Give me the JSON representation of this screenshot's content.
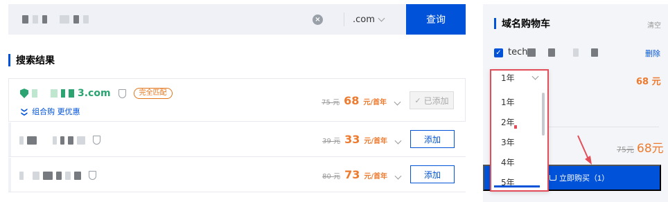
{
  "search": {
    "suffix": ".com",
    "button_label": "查询",
    "clear_symbol": "×"
  },
  "results": {
    "section_title": "搜索结果",
    "rows": [
      {
        "domain_tail": "3.com",
        "match_badge": "完全匹配",
        "combo_link": "组合购 更优惠",
        "old_price": "75 元",
        "price": "68",
        "unit": "元/首年",
        "button_label": "已添加",
        "added": true
      },
      {
        "old_price": "39 元",
        "price": "33",
        "unit": "元/首年",
        "button_label": "添加",
        "added": false
      },
      {
        "old_price": "80 元",
        "price": "73",
        "unit": "元/首年",
        "button_label": "添加",
        "added": false
      }
    ]
  },
  "cart": {
    "title": "域名购物车",
    "clear_label": "清空",
    "item_name": "tech",
    "delete_label": "删除",
    "price": "68 元",
    "selected_term": "1年",
    "total_old": "75元",
    "total_new": "68元",
    "buy_label": "立即购买（1）"
  },
  "term_options": [
    "1年",
    "2年",
    "3年",
    "4年",
    "5年"
  ],
  "colors": {
    "brand_blue": "#0052d9",
    "price_orange": "#ed7b2f",
    "success_green": "#2ba471",
    "annotation_red": "#e34d59"
  }
}
